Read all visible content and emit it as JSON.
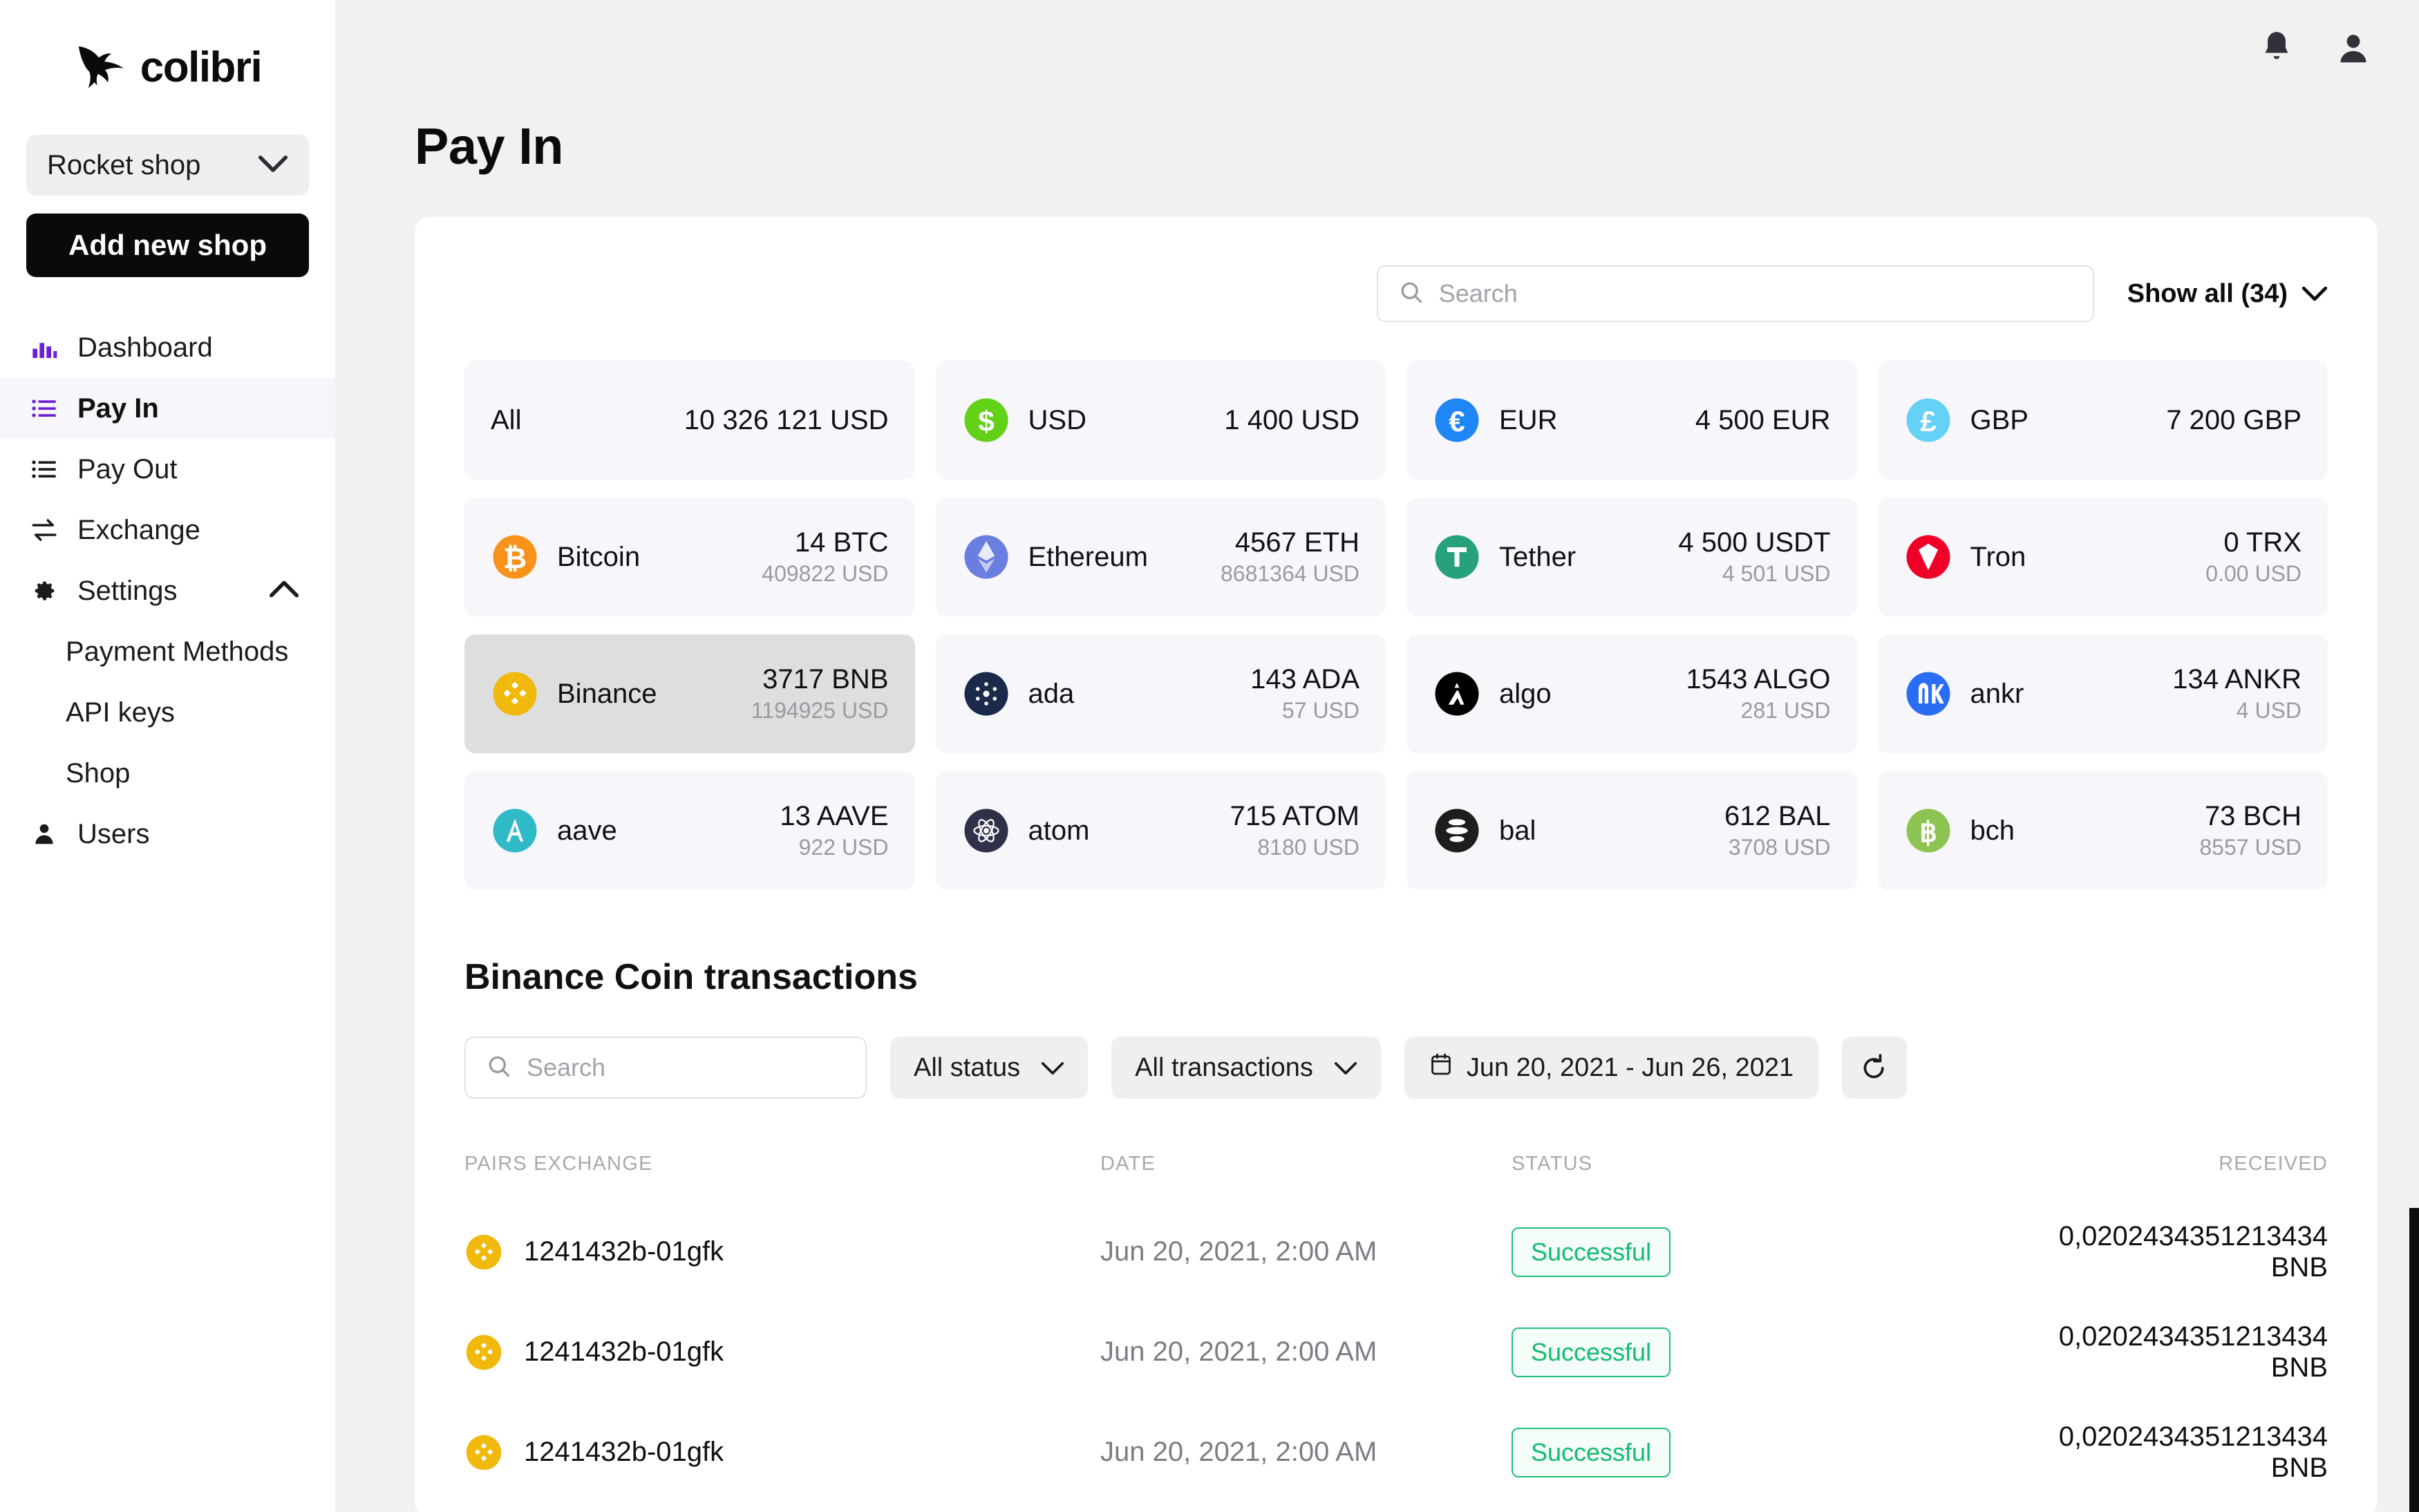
{
  "brand": {
    "name": "colibri",
    "logo_icon": "hummingbird-logo-icon"
  },
  "sidebar": {
    "shop_selector": {
      "value": "Rocket shop",
      "chevron_icon": "chevron-down-icon"
    },
    "add_shop_label": "Add new shop",
    "items": [
      {
        "label": "Dashboard",
        "icon": "bar-chart-icon",
        "active": false
      },
      {
        "label": "Pay In",
        "icon": "list-icon",
        "active": true
      },
      {
        "label": "Pay Out",
        "icon": "list-icon",
        "active": false
      },
      {
        "label": "Exchange",
        "icon": "exchange-arrows-icon",
        "active": false
      },
      {
        "label": "Settings",
        "icon": "gear-icon",
        "active": false,
        "expanded": true,
        "chevron_icon": "chevron-up-icon"
      }
    ],
    "settings_children": [
      {
        "label": "Payment Methods"
      },
      {
        "label": "API keys"
      },
      {
        "label": "Shop"
      }
    ],
    "users_item": {
      "label": "Users",
      "icon": "person-icon"
    }
  },
  "topbar": {
    "notifications_icon": "bell-icon",
    "account_icon": "user-avatar-icon"
  },
  "header": {
    "title": "Pay In"
  },
  "panel": {
    "search": {
      "placeholder": "Search",
      "value": "",
      "icon": "search-icon"
    },
    "show_all": {
      "label": "Show all (34)",
      "chevron_icon": "chevron-down-icon"
    }
  },
  "currencies": [
    {
      "name": "All",
      "icon": "none",
      "amount": "10 326 121 USD",
      "usd": "",
      "selected": false,
      "color": "#000000"
    },
    {
      "name": "USD",
      "icon": "usd-icon",
      "amount": "1 400 USD",
      "usd": "",
      "selected": false,
      "color": "#62d118"
    },
    {
      "name": "EUR",
      "icon": "eur-icon",
      "amount": "4 500 EUR",
      "usd": "",
      "selected": false,
      "color": "#1f86f5"
    },
    {
      "name": "GBP",
      "icon": "gbp-icon",
      "amount": "7 200 GBP",
      "usd": "",
      "selected": false,
      "color": "#66d1f7"
    },
    {
      "name": "Bitcoin",
      "icon": "bitcoin-icon",
      "amount": "14 BTC",
      "usd": "409822 USD",
      "selected": false,
      "color": "#f7931a"
    },
    {
      "name": "Ethereum",
      "icon": "ethereum-icon",
      "amount": "4567 ETH",
      "usd": "8681364 USD",
      "selected": false,
      "color": "#6a7ee0"
    },
    {
      "name": "Tether",
      "icon": "tether-icon",
      "amount": "4 500 USDT",
      "usd": "4 501 USD",
      "selected": false,
      "color": "#26a17b"
    },
    {
      "name": "Tron",
      "icon": "tron-icon",
      "amount": "0 TRX",
      "usd": "0.00 USD",
      "selected": false,
      "color": "#ef0027"
    },
    {
      "name": "Binance",
      "icon": "binance-icon",
      "amount": "3717 BNB",
      "usd": "1194925 USD",
      "selected": true,
      "color": "#f0b90b"
    },
    {
      "name": "ada",
      "icon": "cardano-icon",
      "amount": "143 ADA",
      "usd": "57 USD",
      "selected": false,
      "color": "#1b2a4b"
    },
    {
      "name": "algo",
      "icon": "algorand-icon",
      "amount": "1543 ALGO",
      "usd": "281 USD",
      "selected": false,
      "color": "#000000"
    },
    {
      "name": "ankr",
      "icon": "ankr-icon",
      "amount": "134 ANKR",
      "usd": "4 USD",
      "selected": false,
      "color": "#2a6df4"
    },
    {
      "name": "aave",
      "icon": "aave-icon",
      "amount": "13 AAVE",
      "usd": "922 USD",
      "selected": false,
      "color": "#2ebac6"
    },
    {
      "name": "atom",
      "icon": "cosmos-icon",
      "amount": "715 ATOM",
      "usd": "8180 USD",
      "selected": false,
      "color": "#2e3148"
    },
    {
      "name": "bal",
      "icon": "balancer-icon",
      "amount": "612 BAL",
      "usd": "3708 USD",
      "selected": false,
      "color": "#1e1e1e"
    },
    {
      "name": "bch",
      "icon": "bcash-icon",
      "amount": "73 BCH",
      "usd": "8557 USD",
      "selected": false,
      "color": "#8dc351"
    }
  ],
  "transactions_section": {
    "title": "Binance Coin transactions",
    "search": {
      "placeholder": "Search",
      "value": "",
      "icon": "search-icon"
    },
    "status_filter": {
      "label": "All status",
      "chevron_icon": "chevron-down-icon"
    },
    "type_filter": {
      "label": "All transactions",
      "chevron_icon": "chevron-down-icon"
    },
    "date_range": {
      "label": "Jun 20, 2021 - Jun 26, 2021",
      "icon": "calendar-icon"
    },
    "refresh": {
      "icon": "refresh-icon"
    },
    "columns": [
      "PAIRS EXCHANGE",
      "DATE",
      "STATUS",
      "RECEIVED"
    ],
    "rows": [
      {
        "icon": "binance-icon",
        "pair": "1241432b-01gfk",
        "date": "Jun 20, 2021, 2:00 AM",
        "status": "Successful",
        "received": "0,0202434351213434 BNB"
      },
      {
        "icon": "binance-icon",
        "pair": "1241432b-01gfk",
        "date": "Jun 20, 2021, 2:00 AM",
        "status": "Successful",
        "received": "0,0202434351213434 BNB"
      },
      {
        "icon": "binance-icon",
        "pair": "1241432b-01gfk",
        "date": "Jun 20, 2021, 2:00 AM",
        "status": "Successful",
        "received": "0,0202434351213434 BNB"
      }
    ]
  },
  "colors": {
    "accent": "#6b1fd6",
    "success": "#12bb71",
    "sidebar_active_bg": "#f7f6fa",
    "card_bg": "#f7f6fa",
    "card_selected_bg": "#dededf",
    "page_bg": "#f1f1f1"
  }
}
